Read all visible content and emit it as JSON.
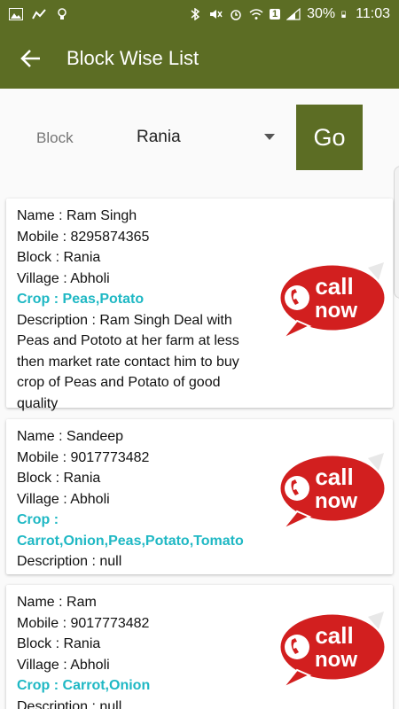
{
  "status_bar": {
    "battery": "30%",
    "time": "11:03",
    "sim_badge": "1"
  },
  "app_bar": {
    "title": "Block Wise List"
  },
  "filter": {
    "block_label": "Block",
    "block_value": "Rania",
    "go_label": "Go"
  },
  "call_badge": {
    "line1": "call",
    "line2": "now"
  },
  "farmers": [
    {
      "name": "Name : Ram Singh",
      "mobile": "Mobile : 8295874365",
      "block": "Block : Rania",
      "village": "Village : Abholi",
      "crop": "Crop : Peas,Potato",
      "description": "Description : Ram Singh Deal with Peas and Pototo at her farm at less then market rate contact him to buy crop of Peas and Potato of good quality"
    },
    {
      "name": "Name : Sandeep",
      "mobile": "Mobile : 9017773482",
      "block": "Block : Rania",
      "village": "Village : Abholi",
      "crop": "Crop : Carrot,Onion,Peas,Potato,Tomato",
      "description": "Description : null"
    },
    {
      "name": "Name : Ram",
      "mobile": "Mobile : 9017773482",
      "block": "Block : Rania",
      "village": "Village : Abholi",
      "crop": "Crop : Carrot,Onion",
      "description": "Description : null"
    }
  ],
  "colors": {
    "primary": "#5c6d24",
    "crop_text": "#1fb8c4",
    "call_red": "#d21f1f"
  }
}
